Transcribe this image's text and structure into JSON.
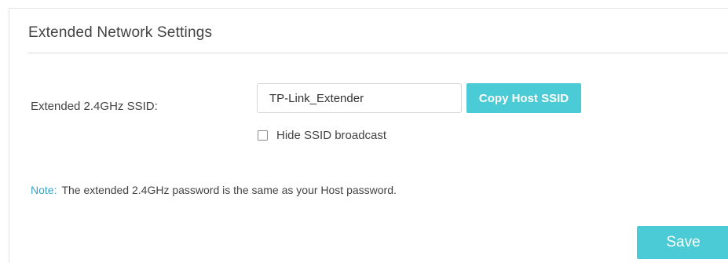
{
  "section": {
    "title": "Extended Network Settings"
  },
  "ssid_field": {
    "label": "Extended 2.4GHz SSID:",
    "value": "TP-Link_Extender"
  },
  "copy_button": {
    "label": "Copy Host SSID"
  },
  "hide_broadcast": {
    "label": "Hide SSID broadcast",
    "checked": false
  },
  "note": {
    "prefix": "Note:",
    "text": "The extended 2.4GHz password is the same as your Host password."
  },
  "save_button": {
    "label": "Save"
  },
  "colors": {
    "accent": "#4acbd6",
    "note_prefix": "#3aa3c9",
    "text": "#444444",
    "divider": "#d9d9d9"
  }
}
